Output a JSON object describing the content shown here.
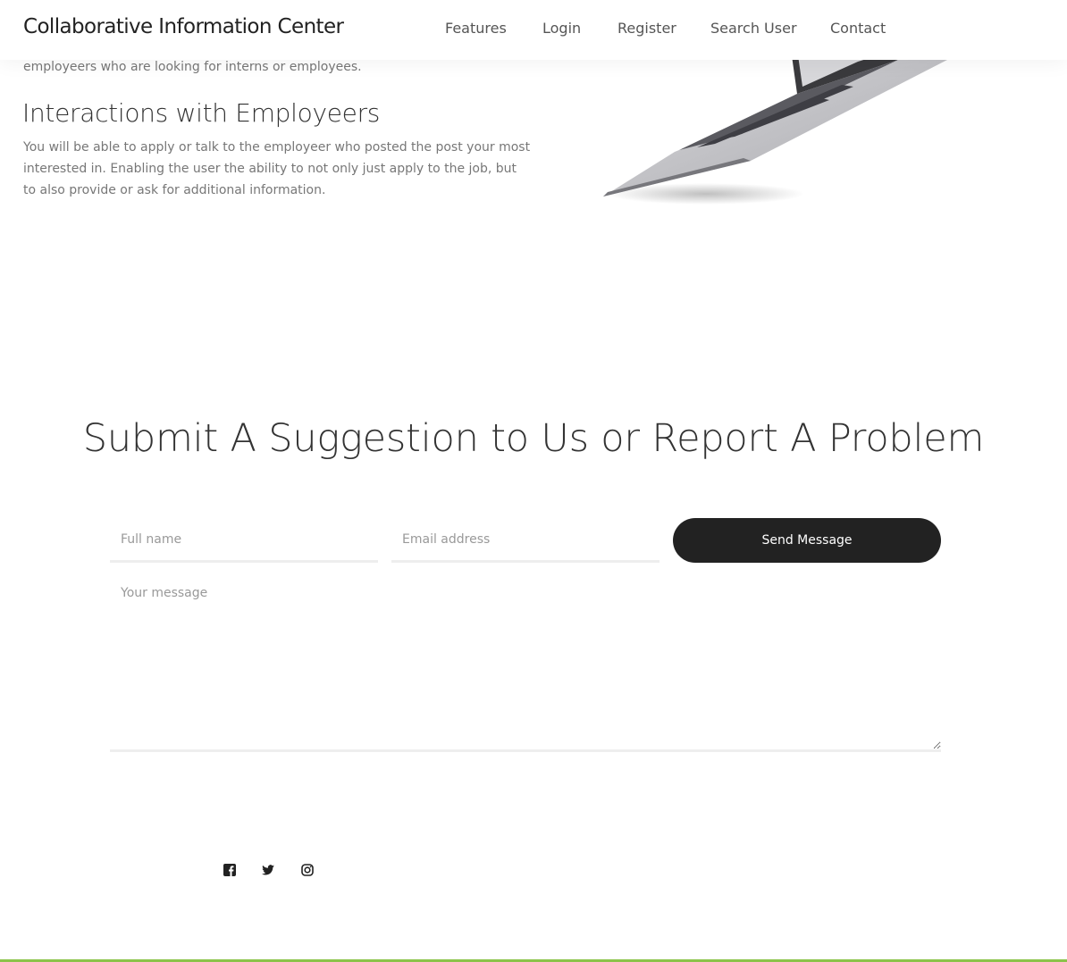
{
  "header": {
    "brand": "Collaborative Information Center",
    "nav": [
      {
        "label": "Features"
      },
      {
        "label": "Login"
      },
      {
        "label": "Register"
      },
      {
        "label": "Search User"
      },
      {
        "label": "Contact"
      }
    ]
  },
  "features": {
    "previous_text": "employeers who are looking for interns or employees.",
    "title": "Interactions with Employeers",
    "description": "You will be able to apply or talk to the employeer who posted the post your most interested in. Enabling the user the ability to not only just apply to the job, but to also provide or ask for additional information."
  },
  "contact": {
    "title": "Submit A Suggestion to Us or Report A Problem",
    "name_placeholder": "Full name",
    "email_placeholder": "Email address",
    "message_placeholder": "Your message",
    "send_label": "Send Message"
  },
  "social": [
    {
      "icon": "facebook-icon"
    },
    {
      "icon": "twitter-icon"
    },
    {
      "icon": "instagram-icon"
    }
  ],
  "colors": {
    "button": "#222222",
    "footer_accent": "#8bc34a"
  }
}
